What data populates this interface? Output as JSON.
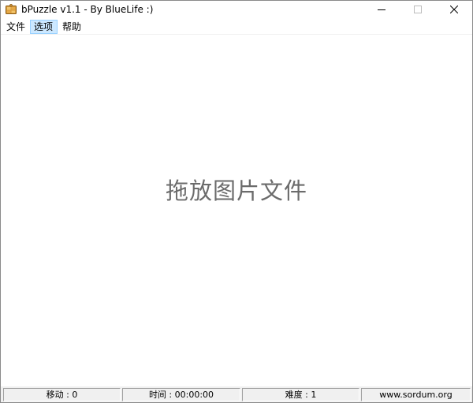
{
  "window": {
    "title": "bPuzzle v1.1 - By BlueLife :)",
    "icon": "puzzle-icon"
  },
  "caption_buttons": {
    "minimize": "minimize-icon",
    "maximize": "maximize-icon",
    "close": "close-icon"
  },
  "menu": {
    "items": [
      {
        "label": "文件"
      },
      {
        "label": "选项"
      },
      {
        "label": "帮助"
      }
    ]
  },
  "main": {
    "drop_hint": "拖放图片文件"
  },
  "statusbar": {
    "moves": "移动 : 0",
    "time": "时间 : 00:00:00",
    "difficulty": "难度 : 1",
    "website": "www.sordum.org"
  },
  "colors": {
    "menu_highlight": "#cce8ff",
    "menu_highlight_border": "#99d1ff",
    "drop_hint_text": "#6b6b6b",
    "statusbar_bg": "#f0f0f0"
  }
}
